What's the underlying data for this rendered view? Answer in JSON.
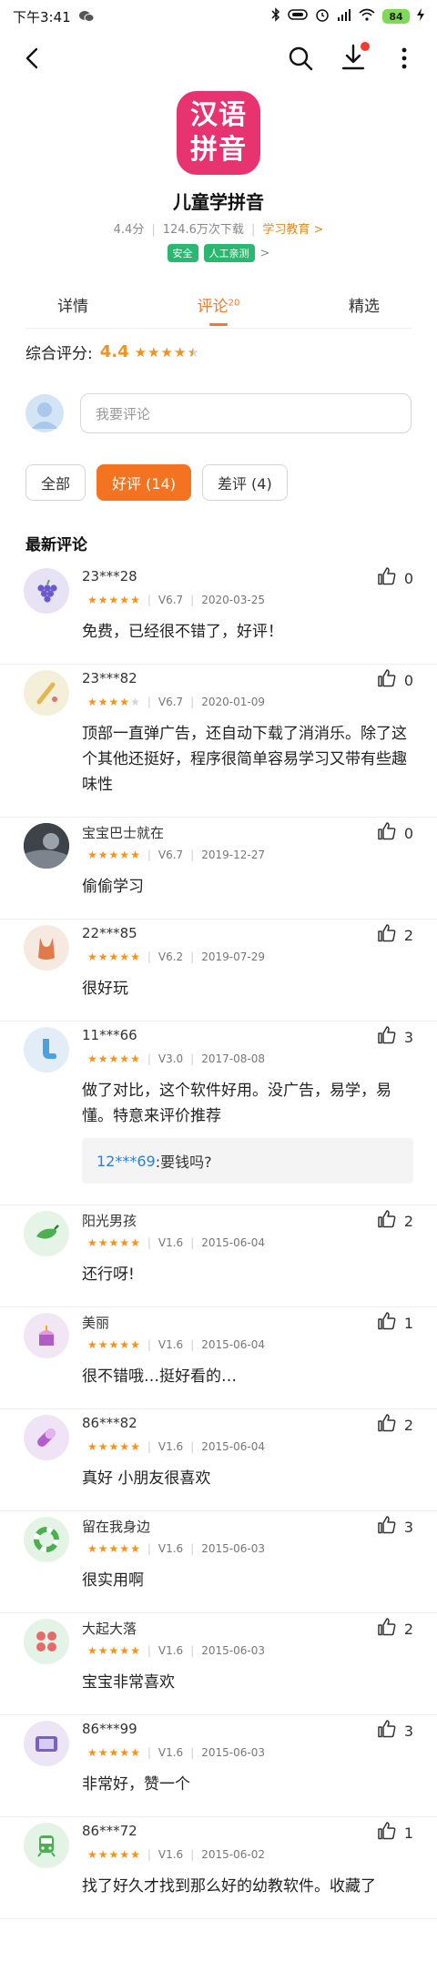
{
  "status_bar": {
    "time": "下午3:41",
    "battery": "84"
  },
  "app": {
    "icon_line1": "汉语",
    "icon_line2": "拼音",
    "name": "儿童学拼音",
    "rating": "4.4分",
    "downloads": "124.6万次下载",
    "category": "学习教育 >",
    "badge_safe": "安全",
    "badge_manual": "人工亲测",
    "badge_arrow": ">"
  },
  "tabs": [
    {
      "label": "详情"
    },
    {
      "label": "评论",
      "count": "20"
    },
    {
      "label": "精选"
    }
  ],
  "overall": {
    "label": "综合评分:",
    "score": "4.4",
    "star_rating": 4.4
  },
  "comment_input": {
    "placeholder": "我要评论"
  },
  "filters": [
    {
      "label": "全部"
    },
    {
      "label": "好评 (14)"
    },
    {
      "label": "差评 (4)"
    }
  ],
  "section_title": "最新评论",
  "reviews": [
    {
      "user": "23***28",
      "stars": 5,
      "version": "V6.7",
      "date": "2020-03-25",
      "likes": "0",
      "text": "免费，已经很不错了，好评！",
      "avatar": "grapes",
      "avatar_color": "#e7e3f4"
    },
    {
      "user": "23***82",
      "stars": 4,
      "version": "V6.7",
      "date": "2020-01-09",
      "likes": "0",
      "text": "顶部一直弹广告，还自动下载了消消乐。除了这个其他还挺好，程序很简单容易学习又带有些趣味性",
      "avatar": "bat",
      "avatar_color": "#f3efd9"
    },
    {
      "user": "宝宝巴士就在",
      "stars": 5,
      "version": "V6.7",
      "date": "2019-12-27",
      "likes": "0",
      "text": "偷偷学习",
      "avatar": "photo",
      "avatar_color": "#4a4f57"
    },
    {
      "user": "22***85",
      "stars": 5,
      "version": "V6.2",
      "date": "2019-07-29",
      "likes": "2",
      "text": "很好玩",
      "avatar": "swimsuit",
      "avatar_color": "#f6e9df"
    },
    {
      "user": "11***66",
      "stars": 5,
      "version": "V3.0",
      "date": "2017-08-08",
      "likes": "3",
      "text": "做了对比，这个软件好用。没广告，易学，易懂。特意来评价推荐",
      "avatar": "sock",
      "avatar_color": "#e2edf7",
      "reply": {
        "name": "12***69",
        "text": ":要钱吗?"
      }
    },
    {
      "user": "阳光男孩",
      "stars": 5,
      "version": "V1.6",
      "date": "2015-06-04",
      "likes": "2",
      "text": "还行呀!",
      "avatar": "pepper",
      "avatar_color": "#e5f4e6"
    },
    {
      "user": "美丽",
      "stars": 5,
      "version": "V1.6",
      "date": "2015-06-04",
      "likes": "1",
      "text": "很不错哦…挺好看的…",
      "avatar": "cake",
      "avatar_color": "#f1e6f4"
    },
    {
      "user": "86***82",
      "stars": 5,
      "version": "V1.6",
      "date": "2015-06-04",
      "likes": "2",
      "text": "真好 小朋友很喜欢",
      "avatar": "pill",
      "avatar_color": "#efe4f5"
    },
    {
      "user": "留在我身边",
      "stars": 5,
      "version": "V1.6",
      "date": "2015-06-03",
      "likes": "3",
      "text": "很实用啊",
      "avatar": "lifebuoy",
      "avatar_color": "#e4f4e4"
    },
    {
      "user": "大起大落",
      "stars": 5,
      "version": "V1.6",
      "date": "2015-06-03",
      "likes": "2",
      "text": "宝宝非常喜欢",
      "avatar": "blocks",
      "avatar_color": "#e3f3e7"
    },
    {
      "user": "86***99",
      "stars": 5,
      "version": "V1.6",
      "date": "2015-06-03",
      "likes": "3",
      "text": "非常好，赞一个",
      "avatar": "tv",
      "avatar_color": "#ece5f6"
    },
    {
      "user": "86***72",
      "stars": 5,
      "version": "V1.6",
      "date": "2015-06-02",
      "likes": "1",
      "text": "找了好久才找到那么好的幼教软件。收藏了",
      "avatar": "train",
      "avatar_color": "#e3f3e6"
    }
  ]
}
